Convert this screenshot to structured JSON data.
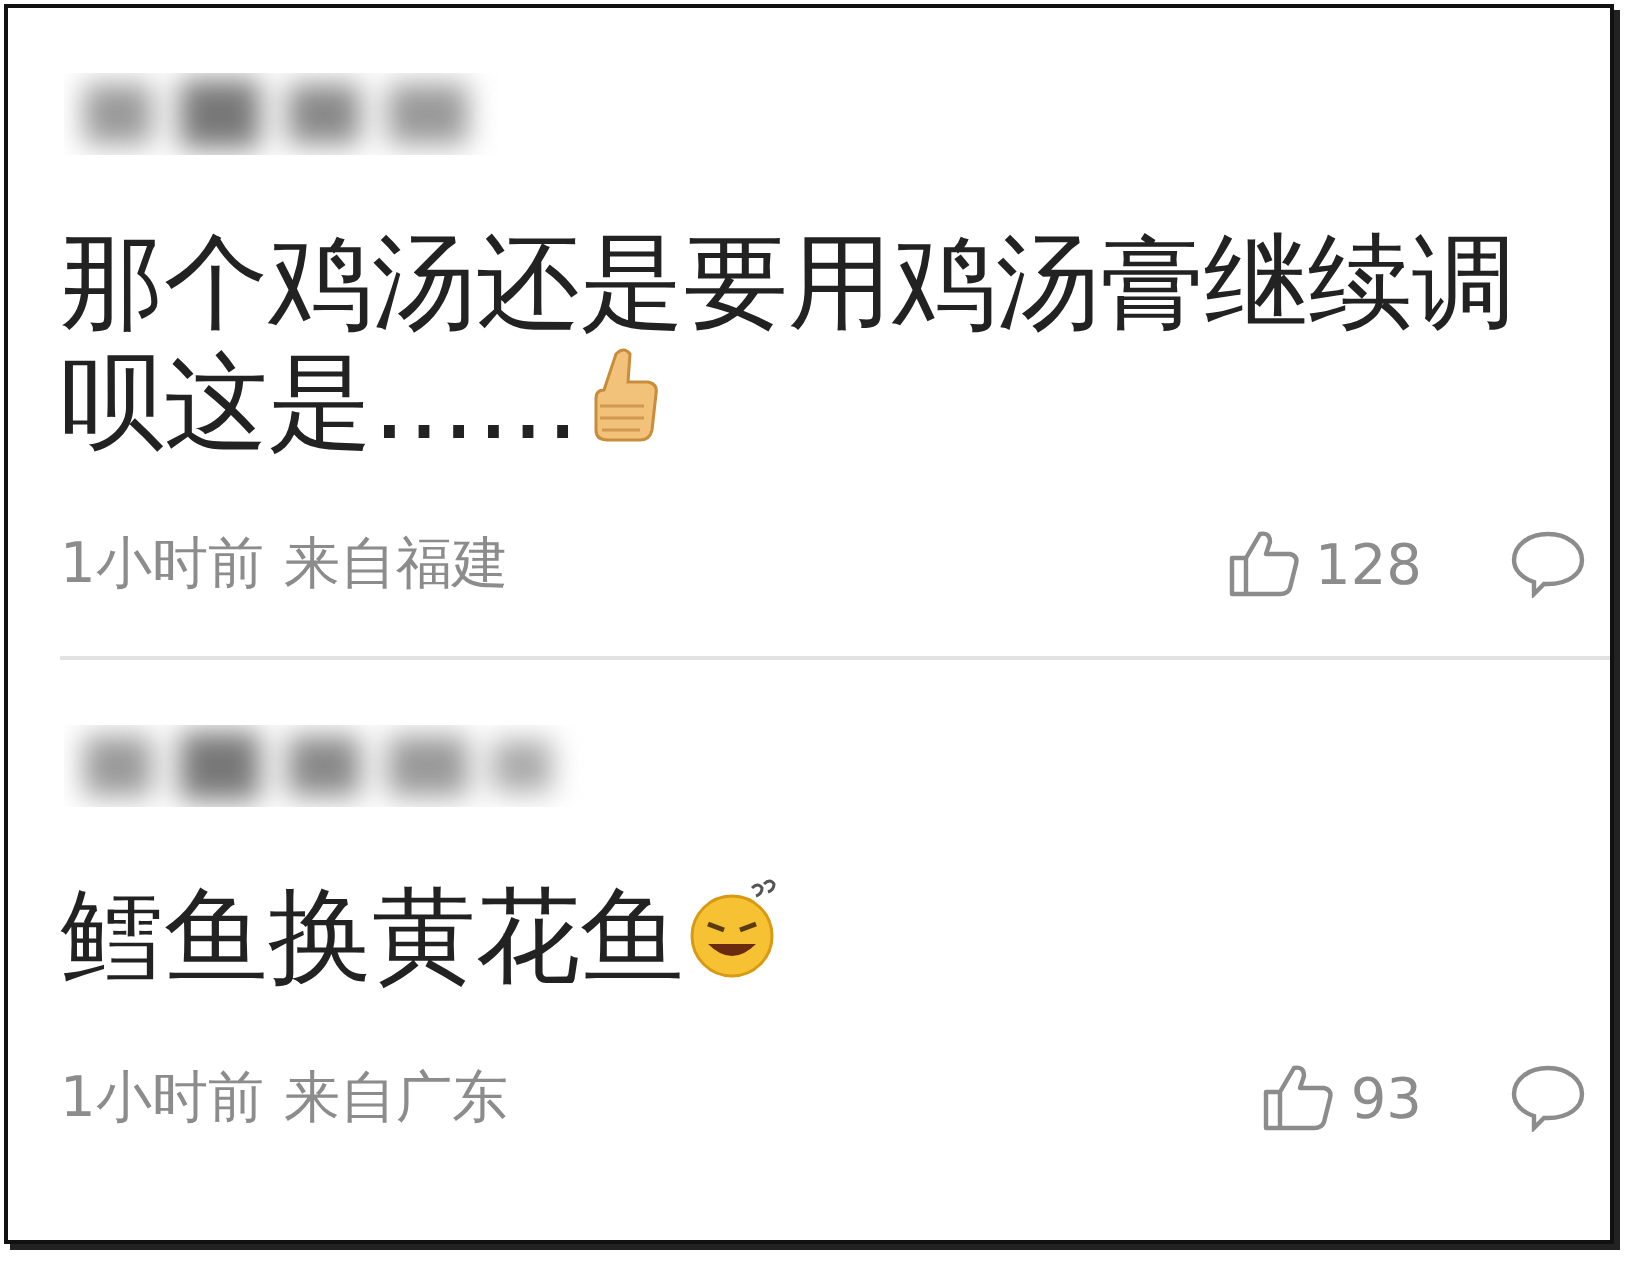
{
  "comments": [
    {
      "text": "那个鸡汤还是要用鸡汤膏继续调呗这是……",
      "emoji": {
        "kind": "thumb"
      },
      "time": "1小时前",
      "location": "来自福建",
      "likes": "128"
    },
    {
      "text": "鳕鱼换黄花鱼",
      "emoji": {
        "kind": "grin"
      },
      "time": "1小时前",
      "location": "来自广东",
      "likes": "93"
    }
  ]
}
